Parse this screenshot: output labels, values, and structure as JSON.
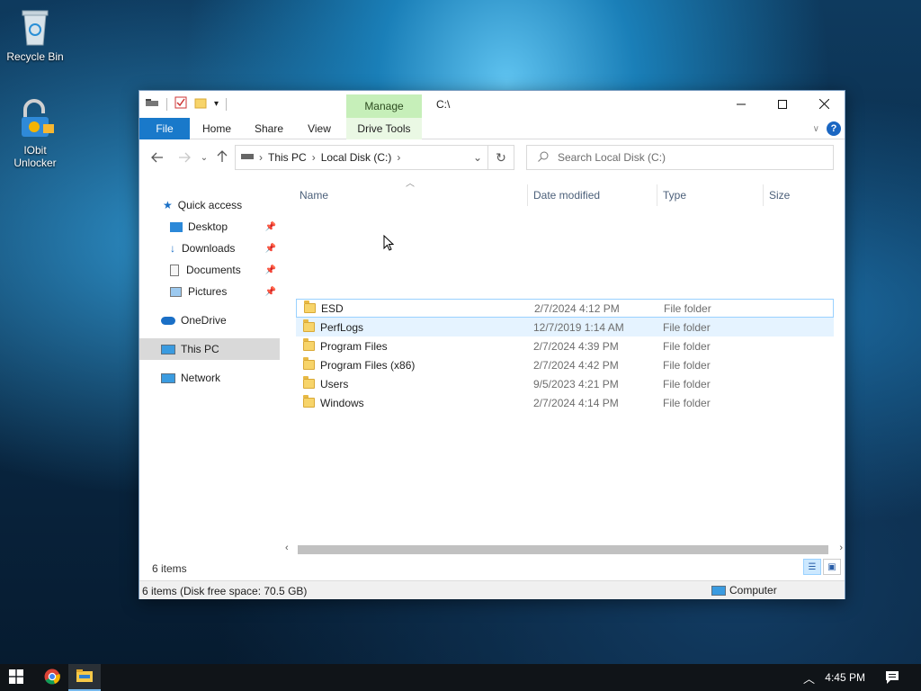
{
  "desktop": {
    "icons": [
      {
        "label": "Recycle Bin",
        "icon": "recycle-bin-icon"
      },
      {
        "label": "IObit Unlocker",
        "icon": "iobit-unlocker-icon"
      }
    ]
  },
  "window": {
    "title_path": "C:\\",
    "manage_tab": "Manage",
    "ribbon_tabs": [
      "File",
      "Home",
      "Share",
      "View",
      "Drive Tools"
    ],
    "controls": {
      "minimize": "–",
      "maximize": "☐",
      "close": "✕"
    }
  },
  "address": {
    "crumbs": [
      "This PC",
      "Local Disk (C:)"
    ],
    "search_placeholder": "Search Local Disk (C:)"
  },
  "navpane": {
    "quick_access": "Quick access",
    "items": [
      "Desktop",
      "Downloads",
      "Documents",
      "Pictures"
    ],
    "onedrive": "OneDrive",
    "this_pc": "This PC",
    "network": "Network"
  },
  "columns": [
    "Name",
    "Date modified",
    "Type",
    "Size"
  ],
  "files": [
    {
      "name": "ESD",
      "date": "2/7/2024 4:12 PM",
      "type": "File folder",
      "size": ""
    },
    {
      "name": "PerfLogs",
      "date": "12/7/2019 1:14 AM",
      "type": "File folder",
      "size": ""
    },
    {
      "name": "Program Files",
      "date": "2/7/2024 4:39 PM",
      "type": "File folder",
      "size": ""
    },
    {
      "name": "Program Files (x86)",
      "date": "2/7/2024 4:42 PM",
      "type": "File folder",
      "size": ""
    },
    {
      "name": "Users",
      "date": "9/5/2023 4:21 PM",
      "type": "File folder",
      "size": ""
    },
    {
      "name": "Windows",
      "date": "2/7/2024 4:14 PM",
      "type": "File folder",
      "size": ""
    }
  ],
  "status": {
    "count": "6 items",
    "bar_left": "6 items (Disk free space: 70.5 GB)",
    "bar_right": "Computer"
  },
  "taskbar": {
    "clock": "4:45 PM"
  }
}
